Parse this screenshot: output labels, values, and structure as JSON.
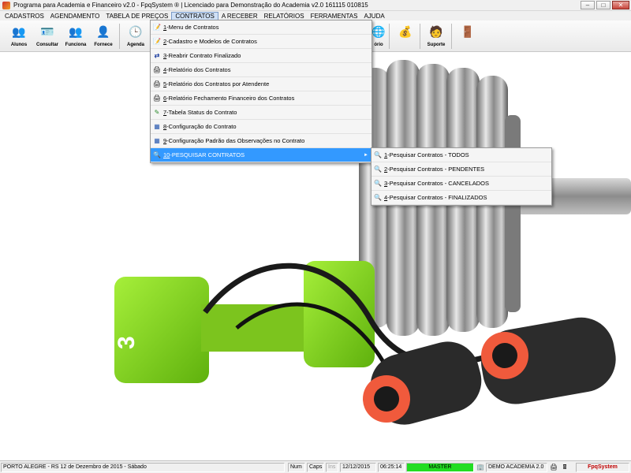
{
  "window": {
    "title": "Programa para Academia e Financeiro v2.0 - FpqSystem ® | Licenciado para  Demonstração do Academia v2.0 161115 010815",
    "controls": {
      "minimize": "–",
      "maximize": "□",
      "close": "✕"
    }
  },
  "menubar": [
    "CADASTROS",
    "AGENDAMENTO",
    "TABELA DE PREÇOS",
    "CONTRATOS",
    "A RECEBER",
    "RELATÓRIOS",
    "FERRAMENTAS",
    "AJUDA"
  ],
  "menubar_active": "CONTRATOS",
  "toolbar": {
    "buttons": [
      {
        "label": "Alunos",
        "icon": "students-icon",
        "glyph": "👥"
      },
      {
        "label": "Consultar",
        "icon": "id-card-icon",
        "glyph": "🪪"
      },
      {
        "label": "Funciona",
        "icon": "employees-icon",
        "glyph": "👥"
      },
      {
        "label": "Fornece",
        "icon": "supplier-icon",
        "glyph": "👤"
      },
      {
        "label": "Agenda",
        "icon": "calendar-icon",
        "glyph": "🕒"
      },
      {
        "label": "ório",
        "icon": "report-icon",
        "glyph": "🌐"
      },
      {
        "label": "",
        "icon": "finance-icon",
        "glyph": "💰"
      },
      {
        "label": "Suporte",
        "icon": "support-icon",
        "glyph": "🧑"
      },
      {
        "label": "",
        "icon": "exit-icon",
        "glyph": "🚪"
      }
    ]
  },
  "contratos_menu": {
    "items": [
      {
        "num": "1",
        "text": "-Menu de Contratos",
        "icon": "contracts-icon",
        "glyph": "📝"
      },
      {
        "num": "2",
        "text": "-Cadastro e Modelos de Contratos",
        "icon": "edit-contract-icon",
        "glyph": "📝"
      },
      {
        "num": "3",
        "text": "-Reabrir Contrato Finalizado",
        "icon": "reopen-icon",
        "glyph": "⇄"
      },
      {
        "num": "4",
        "text": "-Relatório dos Contratos",
        "icon": "printer-icon",
        "glyph": "🖨"
      },
      {
        "num": "5",
        "text": "-Relatório dos Contratos por Atendente",
        "icon": "printer-icon",
        "glyph": "🖨"
      },
      {
        "num": "6",
        "text": "-Relatório Fechamento Financeiro dos Contratos",
        "icon": "printer-icon",
        "glyph": "🖨"
      },
      {
        "num": "7",
        "text": "-Tabela Status do Contrato",
        "icon": "status-icon",
        "glyph": "✎"
      },
      {
        "num": "8",
        "text": "-Configuração do Contrato",
        "icon": "settings-icon",
        "glyph": "▦"
      },
      {
        "num": "9",
        "text": "-Configuração Padrão das Observações no Contrato",
        "icon": "notes-settings-icon",
        "glyph": "▦"
      },
      {
        "num": "10",
        "text": "-PESQUISAR CONTRATOS",
        "icon": "search-icon",
        "glyph": "🔍",
        "submenu": true
      }
    ]
  },
  "pesquisar_submenu": {
    "items": [
      {
        "num": "1",
        "text": "-Pesquisar Contratos - TODOS"
      },
      {
        "num": "2",
        "text": "-Pesquisar Contratos - PENDENTES"
      },
      {
        "num": "3",
        "text": "-Pesquisar Contratos - CANCELADOS"
      },
      {
        "num": "4",
        "text": "-Pesquisar Contratos - FINALIZADOS"
      }
    ]
  },
  "statusbar": {
    "location": "PORTO ALEGRE - RS 12 de Dezembro de 2015 - Sábado",
    "num": "Num",
    "caps": "Caps",
    "ins": "Ins",
    "date": "12/12/2015",
    "time": "06:25:14",
    "user": "MASTER",
    "company": "DEMO ACADEMIA 2.0",
    "brand": "FpqSystem",
    "colors": {
      "user_bg": "#22dd22",
      "brand": "#c00000"
    }
  }
}
